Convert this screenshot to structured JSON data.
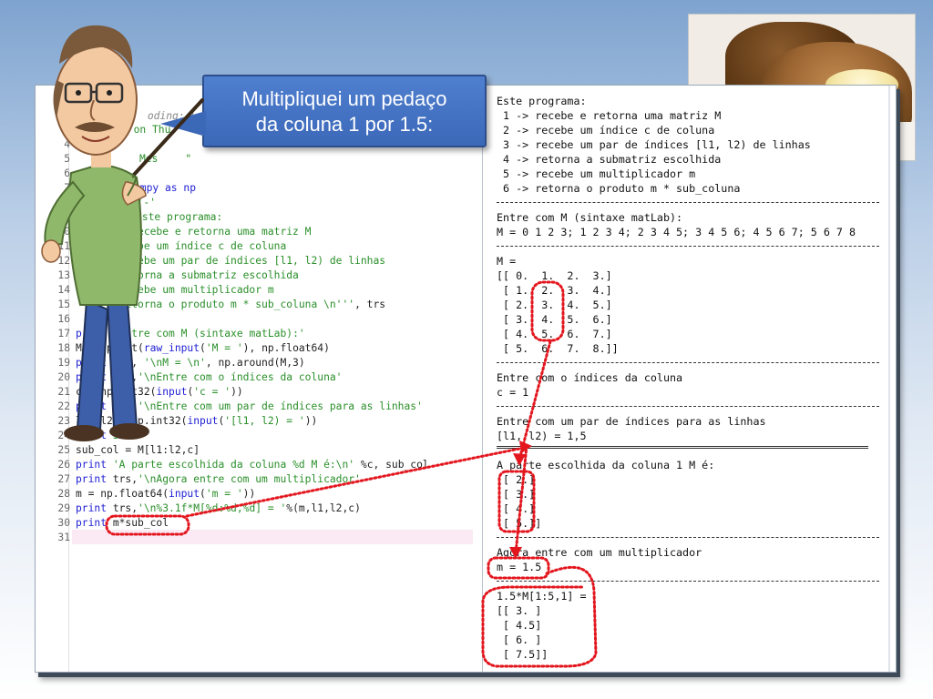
{
  "callout": {
    "line1": "Multipliquei um pedaço",
    "line2": "da coluna 1 por 1.5:"
  },
  "editor": {
    "header_partial": "oding: Lat",
    "line3_partial": "d on Thu",
    "line5_partial": "Mes",
    "line5_quote": "\"",
    "line7_partial": "umpy as np",
    "line8_partial": "t",
    "line8_code": "*'-'",
    "code_lines": [
      {
        "n": "3",
        "text": "d on Thu"
      },
      {
        "n": "4",
        "text": ""
      },
      {
        "n": "5",
        "text": "Mes    \""
      },
      {
        "n": "6",
        "text": ""
      },
      {
        "n": "7",
        "text": "umpy as np"
      },
      {
        "n": "8",
        "text": "t          *'-'"
      },
      {
        "n": "9",
        "text": "pr     '''Este programa:"
      },
      {
        "n": "10",
        "text": "  1      recebe e retorna uma matriz M"
      },
      {
        "n": "11",
        "text": "  2   recebe um índice c de coluna"
      },
      {
        "n": "12",
        "text": "  3 -> recebe um par de índices [l1, l2) de linhas"
      },
      {
        "n": "13",
        "text": "  4 -> retorna a submatriz escolhida"
      },
      {
        "n": "14",
        "text": "  5 -> recebe um multiplicador m"
      },
      {
        "n": "15",
        "text": "  6 -> retorna o produto m * sub_coluna \\n''', trs"
      },
      {
        "n": "16",
        "text": ""
      },
      {
        "n": "17",
        "text": "print 'Entre com M (sintaxe matLab):'"
      },
      {
        "n": "18",
        "text": "M = np.mat(raw_input('M = '), np.float64)"
      },
      {
        "n": "19",
        "text": "print trs, '\\nM = \\n', np.around(M,3)"
      },
      {
        "n": "20",
        "text": "print trs,'\\nEntre com o índices da coluna'"
      },
      {
        "n": "21",
        "text": "c = np.int32(input('c = '))"
      },
      {
        "n": "22",
        "text": "print trs,'\\nEntre com um par de índices para as linhas'"
      },
      {
        "n": "23",
        "text": "l1, l2 = np.int32(input('[l1, l2) = '))"
      },
      {
        "n": "24",
        "text": "print 54*'='"
      },
      {
        "n": "25",
        "text": "sub_col = M[l1:l2,c]"
      },
      {
        "n": "26",
        "text": "print 'A parte escolhida da coluna %d M é:\\n' %c, sub_col"
      },
      {
        "n": "27",
        "text": "print trs,'\\nAgora entre com um multiplicador'"
      },
      {
        "n": "28",
        "text": "m = np.float64(input('m = '))"
      },
      {
        "n": "29",
        "text": "print trs,'\\n%3.1f*M[%d:%d,%d] = '%(m,l1,l2,c)"
      },
      {
        "n": "30",
        "text": "print m*sub_col"
      },
      {
        "n": "31",
        "text": ""
      }
    ]
  },
  "console": {
    "lines": [
      "Este programa:",
      " 1 -> recebe e retorna uma matriz M",
      " 2 -> recebe um índice c de coluna",
      " 3 -> recebe um par de índices [l1, l2) de linhas",
      " 4 -> retorna a submatriz escolhida",
      " 5 -> recebe um multiplicador m",
      " 6 -> retorna o produto m * sub_coluna",
      "Entre com M (sintaxe matLab):",
      "M = 0 1 2 3; 1 2 3 4; 2 3 4 5; 3 4 5 6; 4 5 6 7; 5 6 7 8",
      "M =",
      "[[ 0.  1.  2.  3.]",
      " [ 1.  2.  3.  4.]",
      " [ 2.  3.  4.  5.]",
      " [ 3.  4.  5.  6.]",
      " [ 4.  5.  6.  7.]",
      " [ 5.  6.  7.  8.]]",
      "Entre com o índices da coluna",
      "c = 1",
      "Entre com um par de índices para as linhas",
      "[l1, l2) = 1,5",
      "A parte escolhida da coluna 1 M é:",
      "[[ 2.]",
      " [ 3.]",
      " [ 4.]",
      " [ 5.]]",
      "Agora entre com um multiplicador",
      "m = 1.5",
      "1.5*M[1:5,1] =",
      "[[ 3. ]",
      " [ 4.5]",
      " [ 6. ]",
      " [ 7.5]]"
    ]
  },
  "colors": {
    "callout_fill": "#3c68b8",
    "annotation_red": "#e3161e",
    "keyword_blue": "#1d1dd4",
    "string_green": "#2a8f2a"
  },
  "icons": {
    "cartoon": "professor-pointing-cartoon",
    "photo": "bread-slice-with-butter-photo"
  }
}
